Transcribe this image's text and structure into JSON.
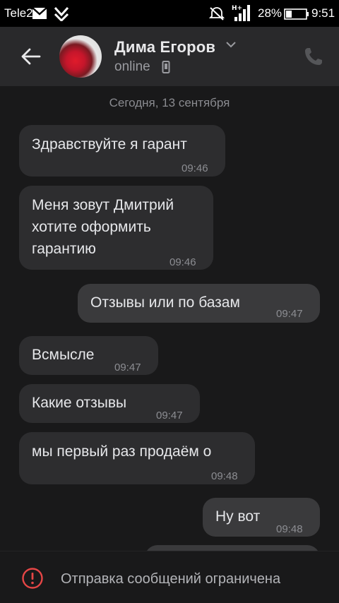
{
  "status_bar": {
    "carrier": "Tele2",
    "battery": "28%",
    "time": "9:51",
    "network_label": "H+"
  },
  "header": {
    "contact_name": "Дима Егоров",
    "status": "online"
  },
  "chat": {
    "date_separator": "Сегодня, 13 сентября",
    "messages": [
      {
        "direction": "in",
        "text": "Здравствуйте я гарант",
        "time": "09:46"
      },
      {
        "direction": "in",
        "text": "Меня зовут Дмитрий\nхотите оформить\nгарантию",
        "time": "09:46"
      },
      {
        "direction": "out",
        "text": "Отзывы или по базам",
        "time": "09:47"
      },
      {
        "direction": "in",
        "text": "Всмысле",
        "time": "09:47"
      },
      {
        "direction": "in",
        "text": "Какие отзывы",
        "time": "09:47"
      },
      {
        "direction": "in",
        "text": "мы первый раз продаём о",
        "time": "09:48"
      },
      {
        "direction": "out",
        "text": "Ну вот",
        "time": "09:48"
      }
    ]
  },
  "footer": {
    "notice": "Отправка сообщений ограничена"
  },
  "colors": {
    "background": "#19191a",
    "header": "#29292b",
    "incoming_bubble": "#2d2d2f",
    "outgoing_bubble": "#3a3a3c",
    "warning": "#e64646"
  },
  "icons": [
    "gmail-icon",
    "vk-notification-icon",
    "mute-icon",
    "signal-icon",
    "battery-icon",
    "back-arrow-icon",
    "chevron-down-icon",
    "mobile-phone-icon",
    "phone-call-icon",
    "warning-icon"
  ]
}
